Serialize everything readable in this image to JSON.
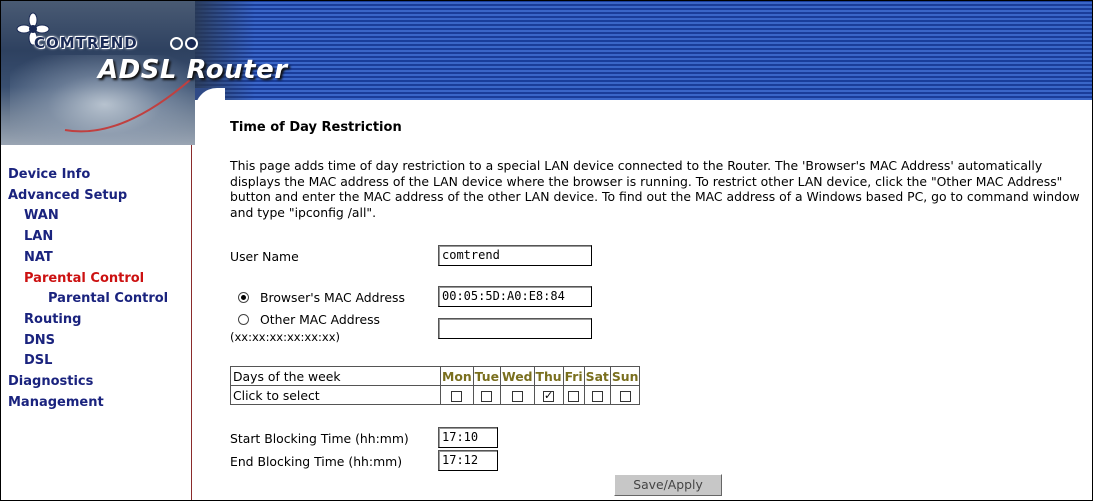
{
  "header": {
    "brand": "COMTREND",
    "product": "ADSL Router"
  },
  "sidebar": {
    "items": [
      {
        "label": "Device Info",
        "level": 0
      },
      {
        "label": "Advanced Setup",
        "level": 0
      },
      {
        "label": "WAN",
        "level": 1
      },
      {
        "label": "LAN",
        "level": 1
      },
      {
        "label": "NAT",
        "level": 1
      },
      {
        "label": "Parental Control",
        "level": 1,
        "active": true
      },
      {
        "label": "Parental Control",
        "level": 2
      },
      {
        "label": "Routing",
        "level": 1
      },
      {
        "label": "DNS",
        "level": 1
      },
      {
        "label": "DSL",
        "level": 1
      },
      {
        "label": "Diagnostics",
        "level": 0
      },
      {
        "label": "Management",
        "level": 0
      }
    ]
  },
  "main": {
    "title": "Time of Day Restriction",
    "description": "This page adds time of day restriction to a special LAN device connected to the Router. The 'Browser's MAC Address' automatically displays the MAC address of the LAN device where the browser is running. To restrict other LAN device, click the \"Other MAC Address\" button and enter the MAC address of the other LAN device. To find out the MAC address of a Windows based PC, go to command window and type \"ipconfig /all\".",
    "user_name_label": "User Name",
    "user_name_value": "comtrend",
    "browser_mac_label": "Browser's MAC Address",
    "browser_mac_value": "00:05:5D:A0:E8:84",
    "other_mac_label": "Other MAC Address",
    "other_mac_hint": "(xx:xx:xx:xx:xx:xx)",
    "other_mac_value": "",
    "selected_mac_option": "browser",
    "days_label": "Days of the week",
    "click_label": "Click to select",
    "days": [
      {
        "name": "Mon",
        "checked": false
      },
      {
        "name": "Tue",
        "checked": false
      },
      {
        "name": "Wed",
        "checked": false
      },
      {
        "name": "Thu",
        "checked": true
      },
      {
        "name": "Fri",
        "checked": false
      },
      {
        "name": "Sat",
        "checked": false
      },
      {
        "name": "Sun",
        "checked": false
      }
    ],
    "start_label": "Start Blocking Time (hh:mm)",
    "start_value": "17:10",
    "end_label": "End Blocking Time (hh:mm)",
    "end_value": "17:12",
    "save_label": "Save/Apply"
  },
  "colors": {
    "nav_text": "#1a237e",
    "nav_active": "#cc1111",
    "day_header": "#7a6f1e",
    "header_stripe": "#1a3d9a"
  }
}
